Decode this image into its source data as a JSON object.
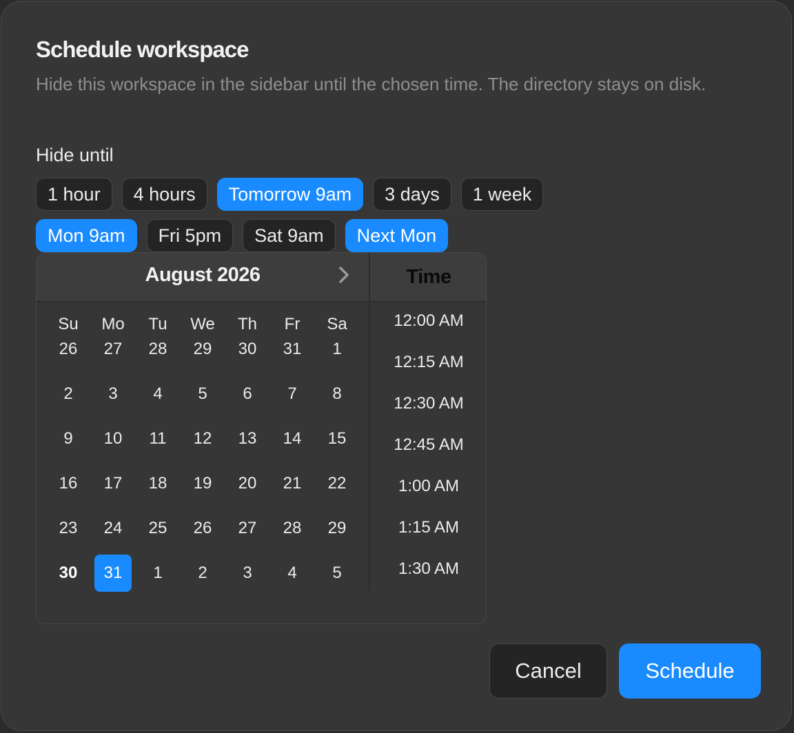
{
  "dialog": {
    "title": "Schedule workspace",
    "description": "Hide this workspace in the sidebar until the chosen time. The directory stays on disk.",
    "hide_until_label": "Hide until"
  },
  "presets": {
    "row1": [
      {
        "label": "1 hour",
        "selected": false
      },
      {
        "label": "4 hours",
        "selected": false
      },
      {
        "label": "Tomorrow 9am",
        "selected": true
      },
      {
        "label": "3 days",
        "selected": false
      },
      {
        "label": "1 week",
        "selected": false
      }
    ],
    "row2": [
      {
        "label": "Mon 9am",
        "selected": true
      },
      {
        "label": "Fri 5pm",
        "selected": false
      },
      {
        "label": "Sat 9am",
        "selected": false
      },
      {
        "label": "Next Mon",
        "selected": true
      }
    ]
  },
  "calendar": {
    "month_label": "August 2026",
    "weekdays": [
      "Su",
      "Mo",
      "Tu",
      "We",
      "Th",
      "Fr",
      "Sa"
    ],
    "weeks": [
      [
        "26",
        "27",
        "28",
        "29",
        "30",
        "31",
        "1"
      ],
      [
        "2",
        "3",
        "4",
        "5",
        "6",
        "7",
        "8"
      ],
      [
        "9",
        "10",
        "11",
        "12",
        "13",
        "14",
        "15"
      ],
      [
        "16",
        "17",
        "18",
        "19",
        "20",
        "21",
        "22"
      ],
      [
        "23",
        "24",
        "25",
        "26",
        "27",
        "28",
        "29"
      ],
      [
        "30",
        "31",
        "1",
        "2",
        "3",
        "4",
        "5"
      ]
    ],
    "today": "30",
    "selected": "31",
    "next_icon": "chevron-right-icon"
  },
  "time": {
    "header": "Time",
    "options": [
      "12:00 AM",
      "12:15 AM",
      "12:30 AM",
      "12:45 AM",
      "1:00 AM",
      "1:15 AM",
      "1:30 AM"
    ]
  },
  "actions": {
    "cancel_label": "Cancel",
    "schedule_label": "Schedule"
  },
  "colors": {
    "accent": "#1a8bff",
    "dialog_bg": "#363636",
    "chip_bg": "#242424"
  }
}
